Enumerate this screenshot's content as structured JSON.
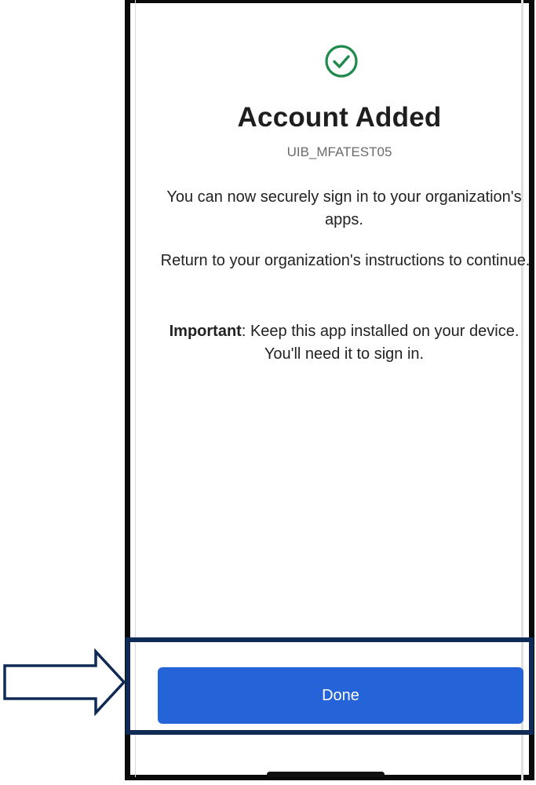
{
  "header": {
    "status_icon": "checkmark-circle-icon",
    "title": "Account Added",
    "account_name": "UIB_MFATEST05"
  },
  "body": {
    "paragraph1": "You can now securely sign in to your organization's apps.",
    "paragraph2": "Return to your organization's instructions to continue.",
    "important_label": "Important",
    "important_text": ": Keep this app installed on your device. You'll need it to sign in."
  },
  "footer": {
    "done_label": "Done"
  },
  "annotation": {
    "arrow_icon": "right-arrow-icon"
  },
  "colors": {
    "accent": "#2563d9",
    "success": "#1f8a4c",
    "highlight_border": "#0f2a55"
  }
}
